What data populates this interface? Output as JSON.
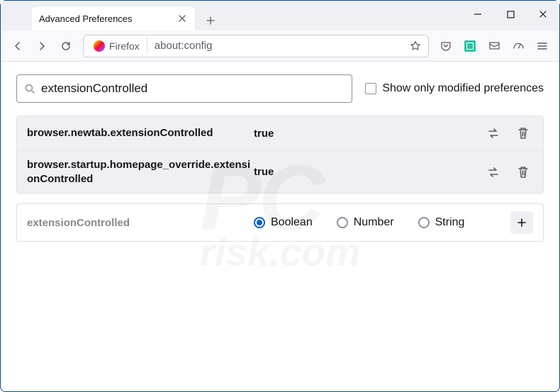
{
  "window": {
    "tab_title": "Advanced Preferences"
  },
  "urlbar": {
    "identity_label": "Firefox",
    "url": "about:config"
  },
  "search": {
    "value": "extensionControlled",
    "checkbox_label": "Show only modified preferences"
  },
  "prefs": [
    {
      "name": "browser.newtab.extensionControlled",
      "value": "true"
    },
    {
      "name": "browser.startup.homepage_override.extensionControlled",
      "value": "true"
    }
  ],
  "newpref": {
    "name": "extensionControlled",
    "types": [
      "Boolean",
      "Number",
      "String"
    ],
    "selected": "Boolean"
  },
  "watermark": {
    "main": "PC",
    "sub": "risk.com"
  }
}
